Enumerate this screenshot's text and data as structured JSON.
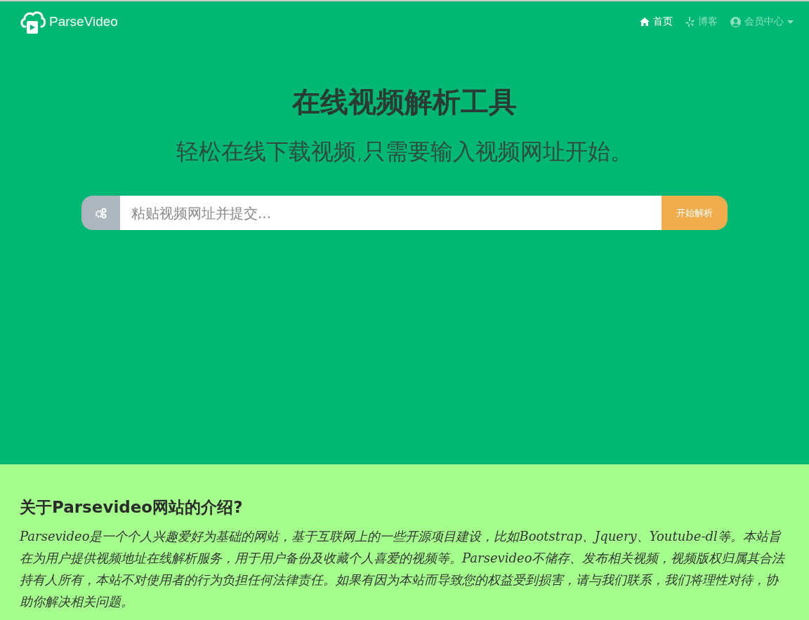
{
  "brand": "ParseVideo",
  "nav": [
    {
      "kind": "home",
      "label": "首页",
      "selected": true
    },
    {
      "kind": "blog",
      "label": "博客",
      "selected": false
    },
    {
      "kind": "user",
      "label": "会员中心",
      "selected": false,
      "dropdown": true
    }
  ],
  "hero": {
    "title": "在线视频解析工具",
    "subtitle": "轻松在线下载视频,只需要输入视频网址开始。"
  },
  "search": {
    "placeholder": "粘贴视频网址并提交...",
    "button": "开始解析"
  },
  "about": {
    "heading": "关于Parsevideo网站的介绍?",
    "text": "Parsevideo是一个个人兴趣爱好为基础的网站，基于互联网上的一些开源项目建设，比如Bootstrap、Jquery、Youtube-dl等。本站旨在为用户提供视频地址在线解析服务，用于用户备份及收藏个人喜爱的视频等。Parsevideo不储存、发布相关视频，视频版权归属其合法持有人所有，本站不对使用者的行为负担任何法律责任。如果有因为本站而导致您的权益受到损害，请与我们联系，我们将理性对待，协助你解决相关问题。"
  }
}
